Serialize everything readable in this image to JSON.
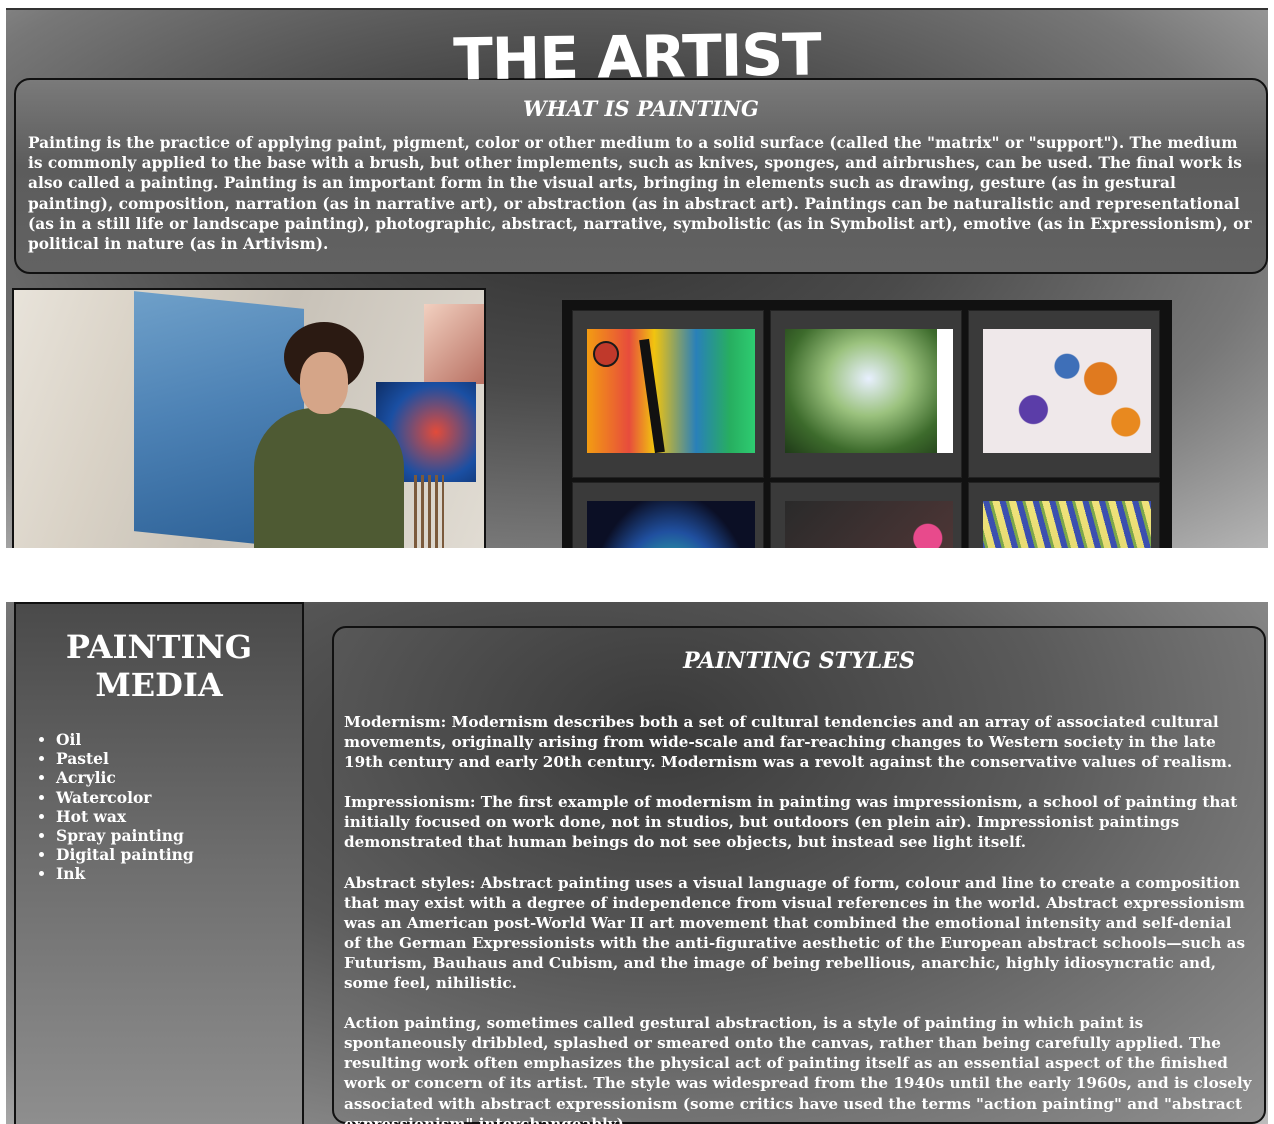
{
  "site": {
    "title": "THE ARTIST"
  },
  "about": {
    "heading": "WHAT IS PAINTING",
    "text": "Painting is the practice of applying paint, pigment, color or other medium to a solid surface (called the \"matrix\" or \"support\"). The medium is commonly applied to the base with a brush, but other implements, such as knives, sponges, and airbrushes, can be used. The final work is also called a painting. Painting is an important form in the visual arts, bringing in elements such as drawing, gesture (as in gestural painting), composition, narration (as in narrative art), or abstraction (as in abstract art). Paintings can be naturalistic and representational (as in a still life or landscape painting), photographic, abstract, narrative, symbolistic (as in Symbolist art), emotive (as in Expressionism), or political in nature (as in Artivism)."
  },
  "media": {
    "heading": "PAINTING MEDIA",
    "items": [
      "Oil",
      "Pastel",
      "Acrylic",
      "Watercolor",
      "Hot wax",
      "Spray painting",
      "Digital painting",
      "Ink"
    ]
  },
  "styles": {
    "heading": "PAINTING STYLES",
    "paragraphs": [
      "Modernism: Modernism describes both a set of cultural tendencies and an array of associated cultural movements, originally arising from wide-scale and far-reaching changes to Western society in the late 19th century and early 20th century. Modernism was a revolt against the conservative values of realism.",
      "Impressionism: The first example of modernism in painting was impressionism, a school of painting that initially focused on work done, not in studios, but outdoors (en plein air). Impressionist paintings demonstrated that human beings do not see objects, but instead see light itself.",
      "Abstract styles: Abstract painting uses a visual language of form, colour and line to create a composition that may exist with a degree of independence from visual references in the world. Abstract expressionism was an American post-World War II art movement that combined the emotional intensity and self-denial of the German Expressionists with the anti-figurative aesthetic of the European abstract schools—such as Futurism, Bauhaus and Cubism, and the image of being rebellious, anarchic, highly idiosyncratic and, some feel, nihilistic.",
      "Action painting, sometimes called gestural abstraction, is a style of painting in which paint is spontaneously dribbled, splashed or smeared onto the canvas, rather than being carefully applied. The resulting work often emphasizes the physical act of painting itself as an essential aspect of the finished work or concern of its artist. The style was widespread from the 1940s until the early 1960s, and is closely associated with abstract expressionism (some critics have used the terms \"action painting\" and \"abstract expressionism\" interchangeably)."
    ]
  },
  "gallery": {
    "images": [
      "colorful-tree-painting",
      "woman-in-garden-painting",
      "paint-pots-photo",
      "night-landscape-painting",
      "pink-flowers-painting",
      "lavender-field-painting"
    ]
  },
  "hero": {
    "image": "woman-painting-canvas-photo"
  }
}
